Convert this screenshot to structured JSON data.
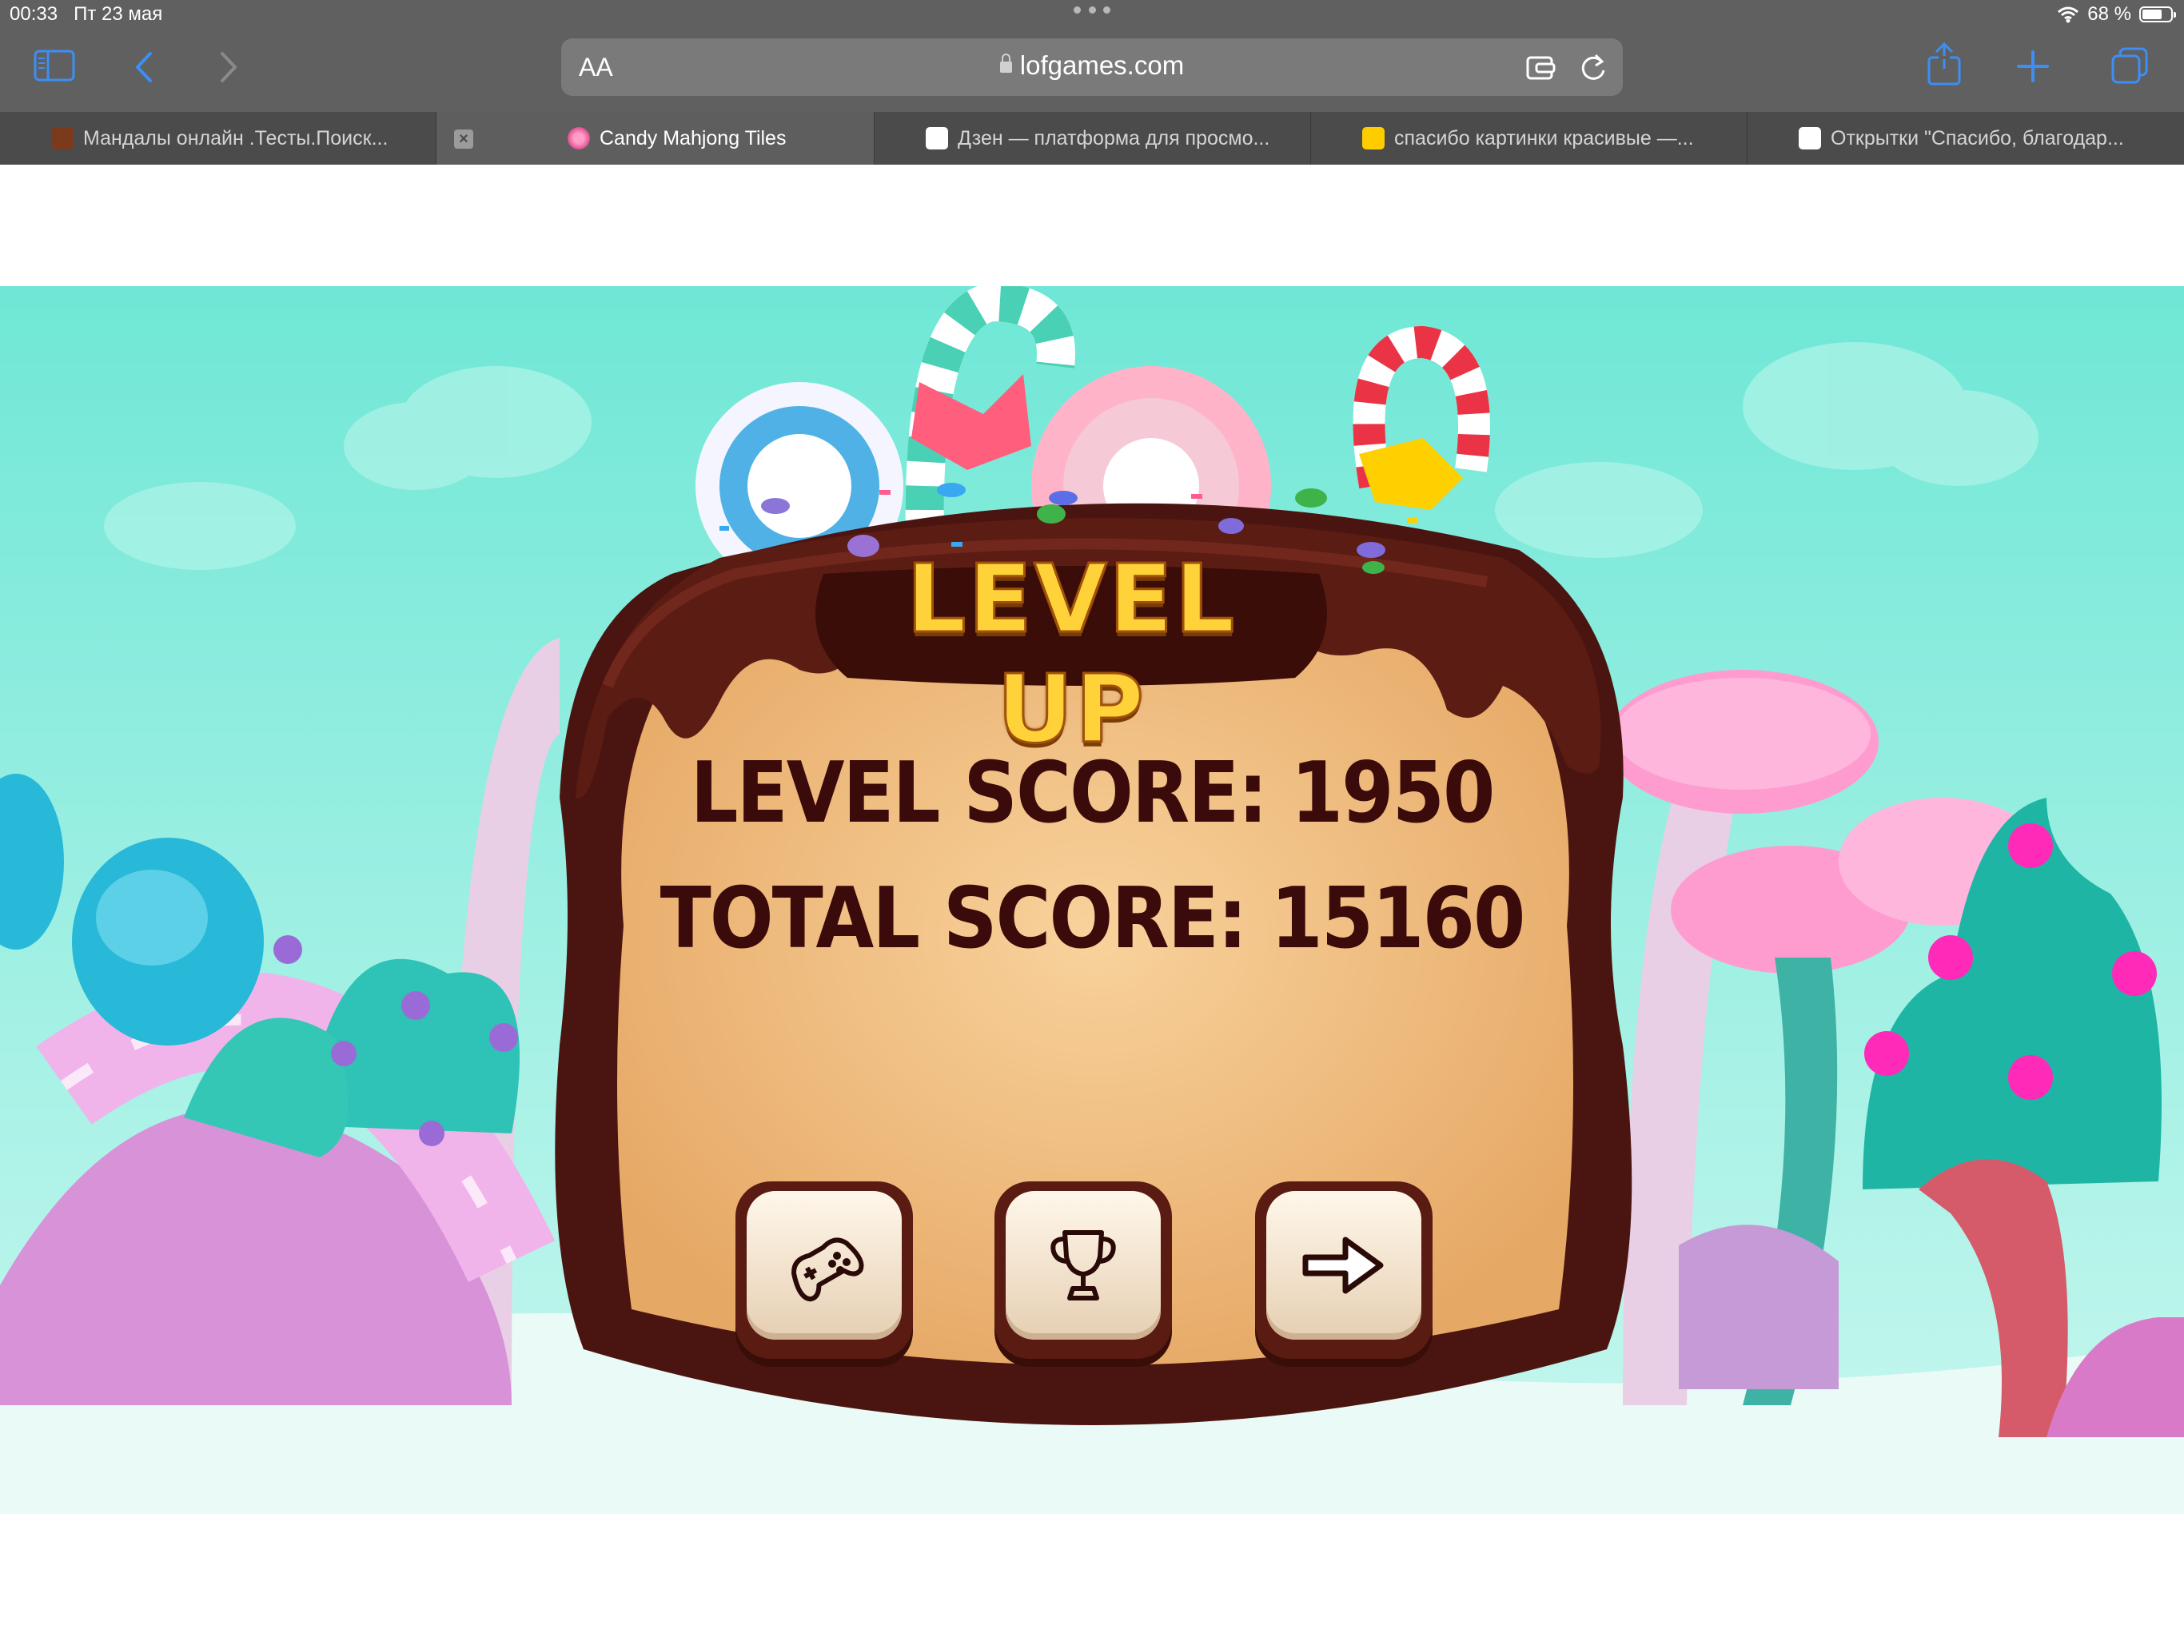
{
  "status_bar": {
    "time": "00:33",
    "date": "Пт 23 мая",
    "battery": "68 %"
  },
  "toolbar": {
    "reader_label": "AA",
    "url": "lofgames.com",
    "icons": [
      "sidebar-icon",
      "back-icon",
      "forward-icon",
      "extension-icon",
      "reload-icon",
      "share-icon",
      "new-tab-icon",
      "tabs-overview-icon"
    ]
  },
  "tabs": [
    {
      "title": "Мандалы онлайн .Тесты.Поиск...",
      "active": false
    },
    {
      "title": "Candy Mahjong Tiles",
      "active": true
    },
    {
      "title": "Дзен — платформа для просмо...",
      "active": false
    },
    {
      "title": "спасибо картинки красивые —...",
      "active": false
    },
    {
      "title": "Открытки \"Спасибо, благодар...",
      "active": false
    }
  ],
  "game": {
    "title": "LEVEL UP",
    "level_score": "LEVEL SCORE: 1950",
    "total_score": "TOTAL SCORE: 15160",
    "buttons": [
      {
        "icon": "gamepad-icon"
      },
      {
        "icon": "trophy-icon"
      },
      {
        "icon": "arrow-right-icon"
      }
    ]
  },
  "colors": {
    "sky": "#72e6d6",
    "chocolate": "#5a1b12",
    "panel": "#f2c58a",
    "score_text": "#3b0a0a",
    "title_text": "#ffd23a"
  }
}
